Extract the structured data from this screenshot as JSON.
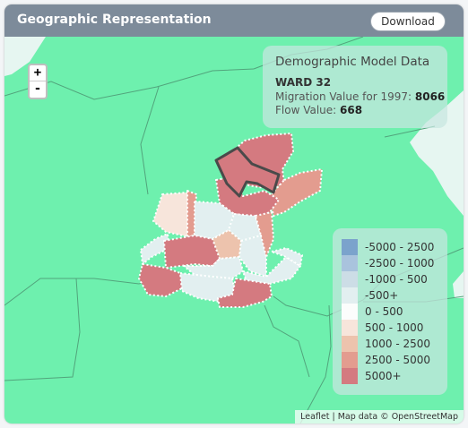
{
  "header": {
    "title": "Geographic Representation",
    "download_label": "Download"
  },
  "map": {
    "zoom_in_label": "+",
    "zoom_out_label": "-",
    "attribution": "Leaflet | Map data © OpenStreetMap",
    "land_color": "#6ef0ae",
    "water_color": "#e6f6f1"
  },
  "info": {
    "heading": "Demographic Model Data",
    "ward": "WARD 32",
    "migration_label": "Migration Value for 1997: ",
    "migration_value": "8066",
    "flow_label": "Flow Value: ",
    "flow_value": "668"
  },
  "legend": {
    "items": [
      {
        "label": "-5000 - 2500",
        "color": "#7ba3cc"
      },
      {
        "label": "-2500 - 1000",
        "color": "#a9c3dd"
      },
      {
        "label": "-1000 - 500",
        "color": "#ccdde6"
      },
      {
        "label": "-500+",
        "color": "#e2eff0"
      },
      {
        "label": "0 - 500",
        "color": "#fbfdfc"
      },
      {
        "label": "500 - 1000",
        "color": "#f7e5db"
      },
      {
        "label": "1000 - 2500",
        "color": "#edc3ad"
      },
      {
        "label": "2500 - 5000",
        "color": "#e39c8f"
      },
      {
        "label": "5000+",
        "color": "#d47a80"
      }
    ]
  }
}
